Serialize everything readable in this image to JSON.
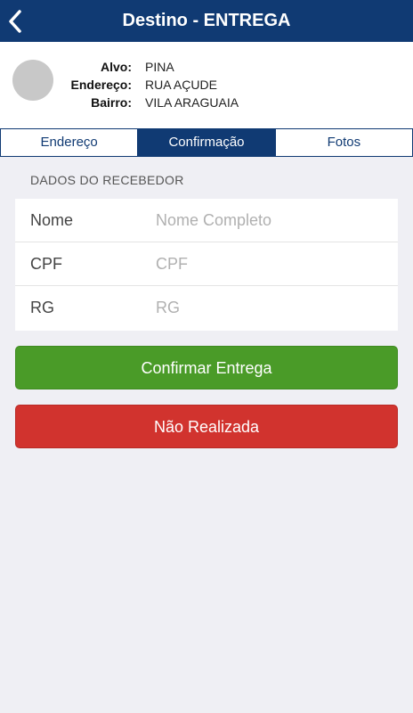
{
  "navbar": {
    "title": "Destino - ENTREGA",
    "back_icon": "chevron-left-icon",
    "background": "#103a73"
  },
  "target": {
    "alvo_label": "Alvo:",
    "alvo_value": "PINA",
    "endereco_label": "Endereço:",
    "endereco_value": "RUA AÇUDE",
    "bairro_label": "Bairro:",
    "bairro_value": "VILA ARAGUAIA"
  },
  "tabs": [
    {
      "label": "Endereço",
      "active": false
    },
    {
      "label": "Confirmação",
      "active": true
    },
    {
      "label": "Fotos",
      "active": false
    }
  ],
  "form": {
    "section_title": "DADOS DO RECEBEDOR",
    "fields": [
      {
        "label": "Nome",
        "placeholder": "Nome Completo",
        "value": ""
      },
      {
        "label": "CPF",
        "placeholder": "CPF",
        "value": ""
      },
      {
        "label": "RG",
        "placeholder": "RG",
        "value": ""
      }
    ]
  },
  "actions": {
    "confirm_label": "Confirmar Entrega",
    "confirm_color": "#4a9b28",
    "cancel_label": "Não Realizada",
    "cancel_color": "#d1332e"
  }
}
